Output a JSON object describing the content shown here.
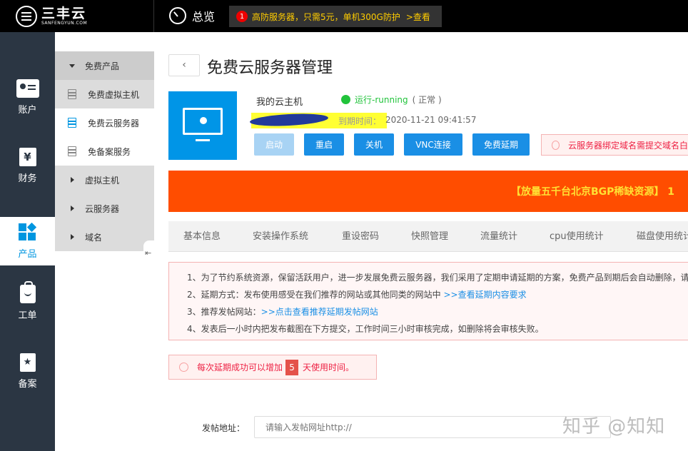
{
  "brand": {
    "name_cn": "三丰云",
    "name_en": "SANFENGYUN.COM"
  },
  "topbar": {
    "overview_label": "总览",
    "notice_count": "1",
    "notice_text": "高防服务器，只需5元，单机300G防护",
    "notice_link": ">查看"
  },
  "leftnav": [
    {
      "label": "账户",
      "icon": "account-card-icon"
    },
    {
      "label": "财务",
      "icon": "yen-ledger-icon"
    },
    {
      "label": "产品",
      "icon": "grid-blocks-icon",
      "active": true
    },
    {
      "label": "工单",
      "icon": "bag-icon"
    },
    {
      "label": "备案",
      "icon": "star-badge-icon"
    }
  ],
  "subnav": {
    "header": "免费产品",
    "items": [
      {
        "label": "免费虚拟主机"
      },
      {
        "label": "免费云服务器",
        "active": true
      },
      {
        "label": "免备案服务"
      }
    ],
    "groups": [
      {
        "label": "虚拟主机"
      },
      {
        "label": "云服务器"
      },
      {
        "label": "域名"
      }
    ]
  },
  "page": {
    "back_symbol": "‹",
    "title": "免费云服务器管理"
  },
  "server": {
    "name": "我的云主机",
    "status": "运行-running",
    "health": "( 正常 )",
    "expire_label": "到期时间：",
    "expire_value": "2020-11-21 09:41:57"
  },
  "actions": [
    {
      "label": "启动",
      "disabled": true
    },
    {
      "label": "重启"
    },
    {
      "label": "关机"
    },
    {
      "label": "VNC连接"
    },
    {
      "label": "免费延期"
    }
  ],
  "domain_tip": "云服务器绑定域名需提交域名白",
  "banner": "【放量五千台北京BGP稀缺资源】 1",
  "tabs": [
    "基本信息",
    "安装操作系统",
    "重设密码",
    "快照管理",
    "流量统计",
    "cpu使用统计",
    "磁盘使用统计"
  ],
  "notes": [
    {
      "text": "1、为了节约系统资源，保留活跃用户，进一步发展免费云服务器，我们采用了定期申请延期的方案，免费产品到期后会自动删除，请"
    },
    {
      "text": "2、延期方式：发布使用感受在我们推荐的网站或其他同类的网站中 ",
      "link": ">>查看延期内容要求"
    },
    {
      "text": "3、推荐发帖网站：",
      "link": ">>点击查看推荐延期发帖网站"
    },
    {
      "text": "4、发表后一小时内把发布截图在下方提交，工作时间三小时审核完成，如删除将会审核失败。"
    }
  ],
  "extend_tip": {
    "before": "每次延期成功可以增加",
    "days": "5",
    "after": "天使用时间。"
  },
  "form": {
    "label": "发帖地址：",
    "placeholder": "请输入发帖网址http://"
  },
  "watermark": "知乎 @知知",
  "colors": {
    "accent": "#1a8fe5",
    "banner": "#ff4d00",
    "status_ok": "#21c33b",
    "sidebar": "#2b3643"
  }
}
